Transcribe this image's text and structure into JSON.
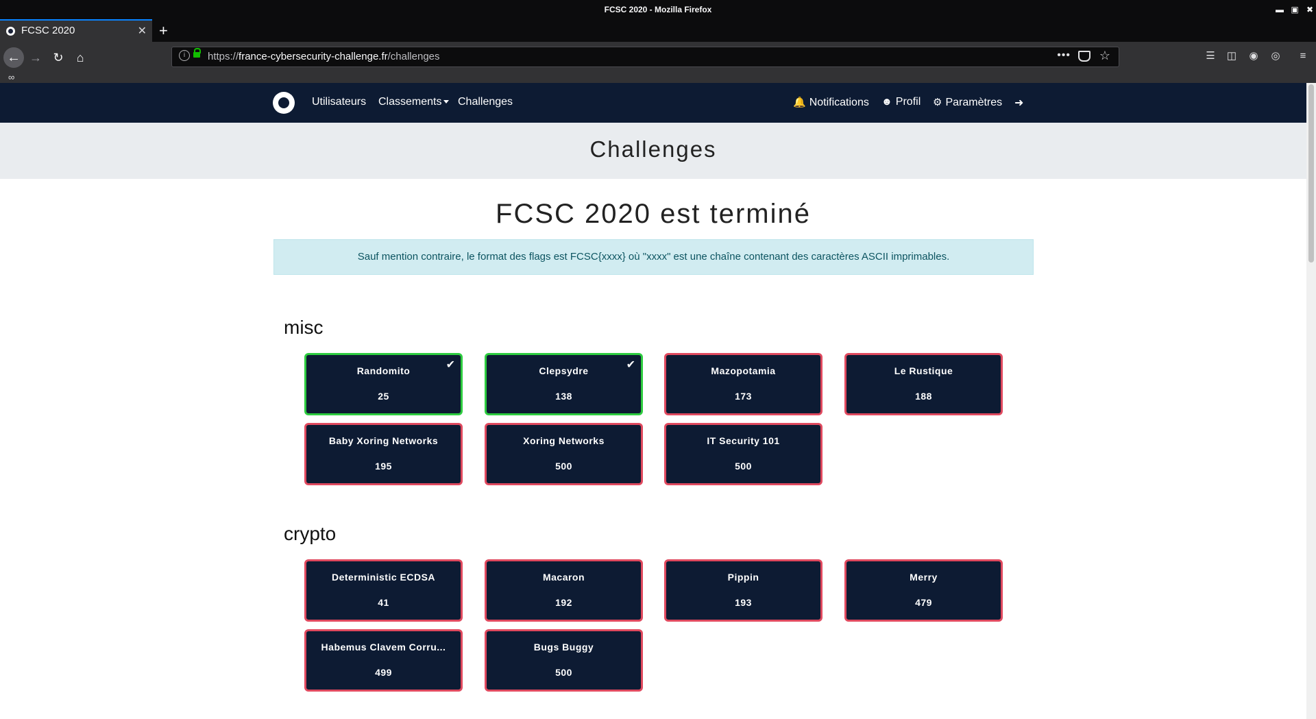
{
  "window": {
    "title": "FCSC 2020 - Mozilla Firefox"
  },
  "tab": {
    "title": "FCSC 2020"
  },
  "url": {
    "prefix": "https://",
    "host": "france-cybersecurity-challenge.fr",
    "path": "/challenges"
  },
  "site_nav": {
    "links": [
      "Utilisateurs",
      "Classements",
      "Challenges"
    ],
    "right": [
      "Notifications",
      "Profil",
      "Paramètres"
    ]
  },
  "page": {
    "header": "Challenges",
    "headline": "FCSC 2020 est terminé",
    "alert": "Sauf mention contraire, le format des flags est FCSC{xxxx} où \"xxxx\" est une chaîne contenant des caractères ASCII imprimables."
  },
  "sections": [
    {
      "title": "misc",
      "challenges": [
        {
          "name": "Randomito",
          "points": "25",
          "solved": true
        },
        {
          "name": "Clepsydre",
          "points": "138",
          "solved": true
        },
        {
          "name": "Mazopotamia",
          "points": "173",
          "solved": false
        },
        {
          "name": "Le Rustique",
          "points": "188",
          "solved": false
        },
        {
          "name": "Baby Xoring Networks",
          "points": "195",
          "solved": false
        },
        {
          "name": "Xoring Networks",
          "points": "500",
          "solved": false
        },
        {
          "name": "IT Security 101",
          "points": "500",
          "solved": false
        }
      ]
    },
    {
      "title": "crypto",
      "challenges": [
        {
          "name": "Deterministic ECDSA",
          "points": "41",
          "solved": false
        },
        {
          "name": "Macaron",
          "points": "192",
          "solved": false
        },
        {
          "name": "Pippin",
          "points": "193",
          "solved": false
        },
        {
          "name": "Merry",
          "points": "479",
          "solved": false
        },
        {
          "name": "Habemus Clavem Corru...",
          "points": "499",
          "solved": false
        },
        {
          "name": "Bugs Buggy",
          "points": "500",
          "solved": false
        }
      ]
    }
  ]
}
